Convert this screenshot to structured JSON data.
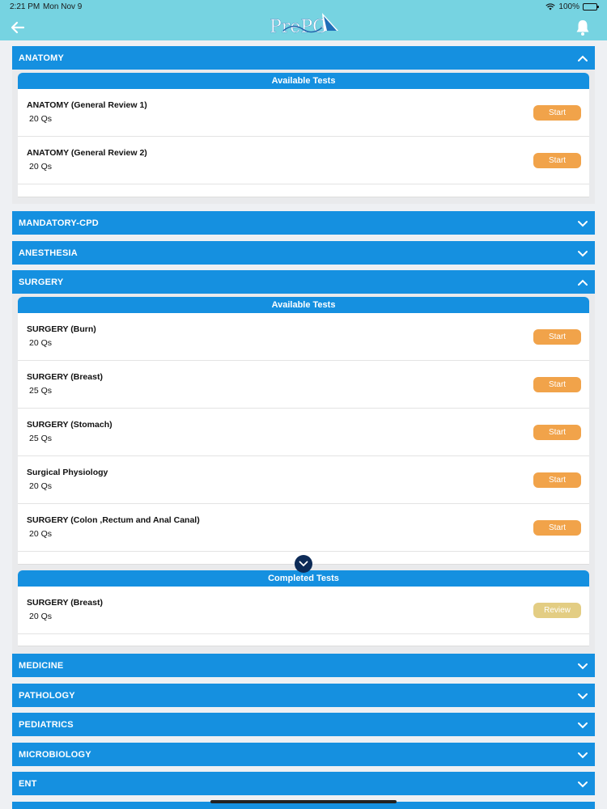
{
  "status_bar": {
    "time": "2:21 PM",
    "date": "Mon Nov 9",
    "battery": "100%"
  },
  "header": {
    "logo_text": "PrePG",
    "back_icon": "arrow-left-icon",
    "notification_icon": "bell-icon"
  },
  "colors": {
    "header_bg": "#76d3e1",
    "accordion_bg": "#1590e0",
    "start_button": "#f1a34a",
    "review_button": "#e3cd83"
  },
  "accordions": {
    "anatomy": {
      "title": "ANATOMY",
      "expanded": true,
      "available_label": "Available Tests",
      "tests": [
        {
          "name": "ANATOMY (General Review 1)",
          "questions": "20 Qs",
          "action": "Start"
        },
        {
          "name": "ANATOMY (General Review 2)",
          "questions": "20 Qs",
          "action": "Start"
        }
      ]
    },
    "mandatory_cpd": {
      "title": "MANDATORY-CPD",
      "expanded": false
    },
    "anesthesia": {
      "title": "ANESTHESIA",
      "expanded": false
    },
    "surgery": {
      "title": "SURGERY",
      "expanded": true,
      "available_label": "Available Tests",
      "tests": [
        {
          "name": "SURGERY (Burn)",
          "questions": "20 Qs",
          "action": "Start"
        },
        {
          "name": "SURGERY (Breast)",
          "questions": "25 Qs",
          "action": "Start"
        },
        {
          "name": "SURGERY (Stomach)",
          "questions": "25 Qs",
          "action": "Start"
        },
        {
          "name": "Surgical Physiology",
          "questions": "20 Qs",
          "action": "Start"
        },
        {
          "name": "SURGERY (Colon ,Rectum and Anal Canal)",
          "questions": "20 Qs",
          "action": "Start"
        }
      ],
      "completed_label": "Completed Tests",
      "completed": [
        {
          "name": "SURGERY (Breast)",
          "questions": "20 Qs",
          "action": "Review"
        }
      ]
    },
    "medicine": {
      "title": "MEDICINE",
      "expanded": false
    },
    "pathology": {
      "title": "PATHOLOGY",
      "expanded": false
    },
    "pediatrics": {
      "title": "PEDIATRICS",
      "expanded": false
    },
    "microbiology": {
      "title": "MICROBIOLOGY",
      "expanded": false
    },
    "ent": {
      "title": "ENT",
      "expanded": false
    }
  }
}
